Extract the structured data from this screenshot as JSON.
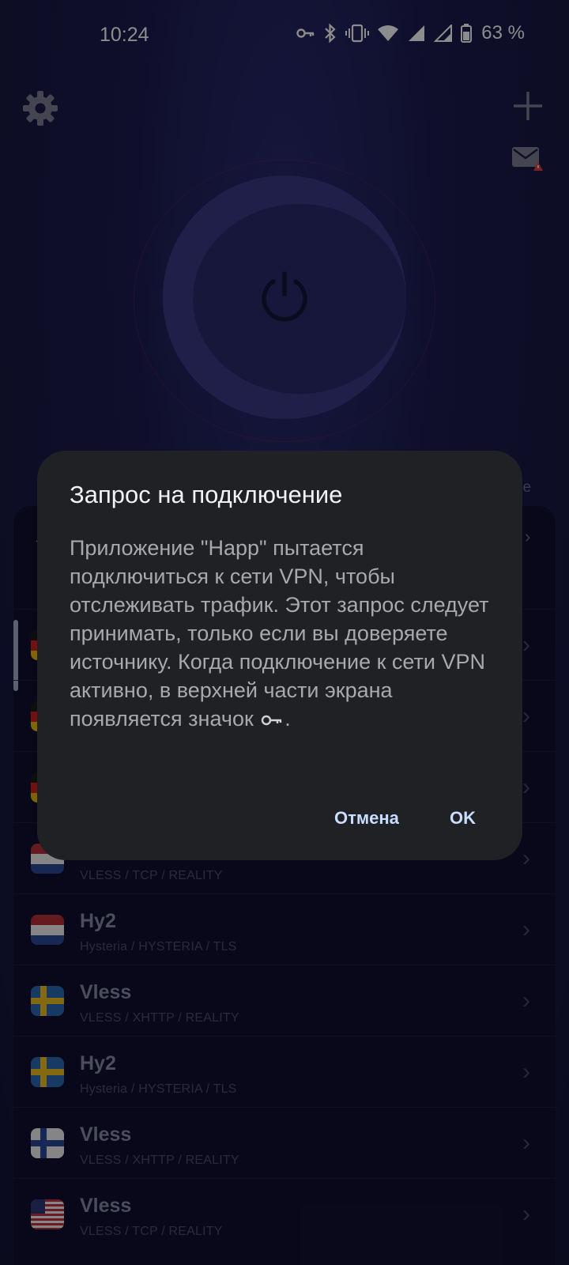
{
  "status_bar": {
    "time": "10:24",
    "battery": "63 %"
  },
  "side_label": "ce",
  "servers": [
    {
      "name": "",
      "proto": "",
      "flag": "de"
    },
    {
      "name": "",
      "proto": "",
      "flag": "de"
    },
    {
      "name": "",
      "proto": "",
      "flag": "de"
    },
    {
      "name": "",
      "proto": "VLESS / TCP / REALITY",
      "flag": "nl"
    },
    {
      "name": "Hy2",
      "proto": "Hysteria / HYSTERIA / TLS",
      "flag": "nl"
    },
    {
      "name": "Vless",
      "proto": "VLESS / XHTTP / REALITY",
      "flag": "se"
    },
    {
      "name": "Hy2",
      "proto": "Hysteria / HYSTERIA / TLS",
      "flag": "se"
    },
    {
      "name": "Vless",
      "proto": "VLESS / XHTTP / REALITY",
      "flag": "fi"
    },
    {
      "name": "Vless",
      "proto": "VLESS / TCP / REALITY",
      "flag": "us"
    }
  ],
  "dialog": {
    "title": "Запрос на подключение",
    "body_before_icon": "Приложение \"Happ\" пытается подключиться к сети VPN, чтобы отслеживать трафик. Этот запрос следует принимать, только если вы доверяете источнику. Когда подключение к сети VPN активно, в верхней части экрана появляется значок",
    "body_after_icon": ".",
    "cancel_label": "Отмена",
    "ok_label": "OK"
  },
  "colors": {
    "accent": "#c8ddff",
    "dialog_bg": "#1f2125",
    "app_bg": "#1c1c50"
  }
}
